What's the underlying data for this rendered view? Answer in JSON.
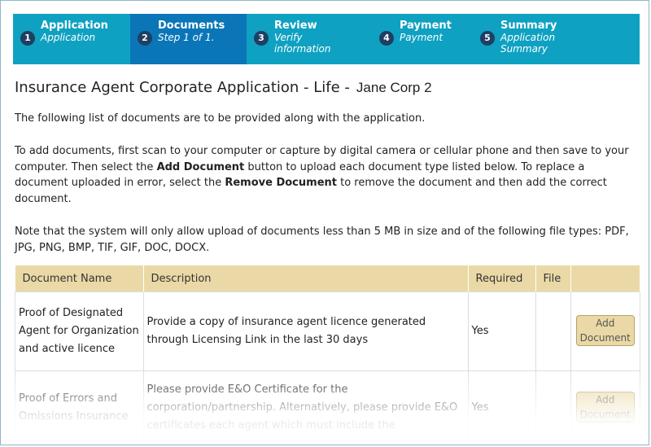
{
  "steps": [
    {
      "num": "1",
      "title": "Application",
      "sub": "Application"
    },
    {
      "num": "2",
      "title": "Documents",
      "sub": "Step 1 of 1."
    },
    {
      "num": "3",
      "title": "Review",
      "sub": "Verify information"
    },
    {
      "num": "4",
      "title": "Payment",
      "sub": "Payment"
    },
    {
      "num": "5",
      "title": "Summary",
      "sub": "Application Summary"
    }
  ],
  "heading": {
    "title": "Insurance Agent Corporate Application - Life -",
    "agent": "Jane Corp 2"
  },
  "intro": "The following list of documents are to be provided along with the application.",
  "instructions": {
    "p1": "To add documents, first scan to your computer or capture by digital camera or cellular phone and then save to your computer. Then select the",
    "add_label": "Add Document",
    "p2": "button to upload each document type listed below. To replace a document uploaded in error, select the",
    "remove_label": "Remove Document",
    "p3": "to remove the document and then add the correct document."
  },
  "note": "Note that the system will only allow upload of documents less than 5 MB in size and of the following file types: PDF, JPG, PNG, BMP, TIF, GIF, DOC, DOCX.",
  "table": {
    "headers": [
      "Document Name",
      "Description",
      "Required",
      "File",
      ""
    ],
    "rows": [
      {
        "name": "Proof of Designated Agent for Organization and active licence",
        "description": "Provide a copy of insurance agent licence generated through Licensing Link in the last 30 days",
        "required": "Yes",
        "file": "",
        "button": "Add Document"
      },
      {
        "name": "Proof of Errors and Omissions Insurance",
        "description": "Please provide E&O Certificate for the corporation/partnership. Alternatively, please provide E&O certificates each agent which must include the",
        "required": "Yes",
        "file": "",
        "button": "Add Document"
      }
    ]
  },
  "colors": {
    "stepper": "#0fa1c1",
    "active_step": "#0a76b8",
    "table_header": "#ead9a6"
  }
}
